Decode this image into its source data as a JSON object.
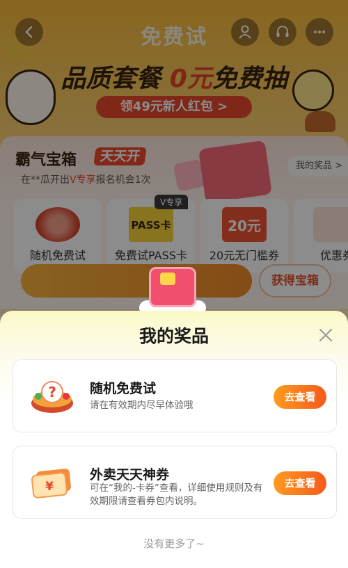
{
  "header": {
    "title": "免费试",
    "back_icon": "back-arrow-icon",
    "actions": [
      "user-icon",
      "headset-icon",
      "more-icon"
    ]
  },
  "banner": {
    "headline_pre": "品质套餐 ",
    "headline_zero": "0元",
    "headline_post": "免费抽",
    "coupon_pill": "领49元新人红包 >"
  },
  "box_section": {
    "title": "霸气宝箱",
    "title_tag": "天天开",
    "marquee_pre": "在**瓜开出",
    "marquee_highlight": "V专享",
    "marquee_post": "报名机会1次",
    "my_prizes_link": "我的奖品 >",
    "prizes": [
      {
        "label": "随机免费试"
      },
      {
        "label": "免费试PASS卡",
        "badge": "V专享",
        "pic_text": "PASS卡"
      },
      {
        "label": "20元无门槛券",
        "pic_text": "20元"
      },
      {
        "label": "优惠券"
      }
    ],
    "get_box_button": "获得宝箱"
  },
  "sheet": {
    "title": "我的奖品",
    "close_icon": "close-icon",
    "items": [
      {
        "name": "随机免费试",
        "desc": "请在有效期内尽早体验哦",
        "button": "去查看",
        "icon": "mystery-bowl-icon"
      },
      {
        "name": "外卖天天神券",
        "desc": "可在“我的-卡券”查看，详细使用规则及有效期限请查看券包内说明。",
        "button": "去查看",
        "icon": "yuan-coupon-icon"
      }
    ],
    "footer": "没有更多了~"
  },
  "colors": {
    "accent_red": "#e8462a",
    "button_orange_start": "#ff9b1f",
    "button_orange_end": "#f45a1a",
    "overlay": "rgba(0,0,0,0.45)"
  }
}
